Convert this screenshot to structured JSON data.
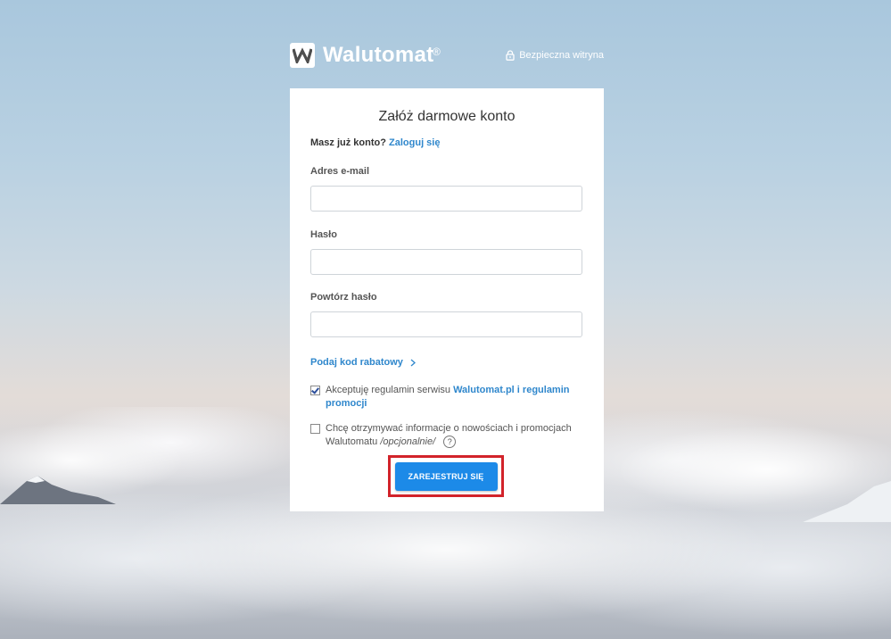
{
  "brand": {
    "name": "Walutomat",
    "mark": "W",
    "registered": "®",
    "secure_label": "Bezpieczna witryna"
  },
  "form": {
    "title": "Załóż darmowe konto",
    "have_account": "Masz już konto?",
    "login_link": "Zaloguj się",
    "email_label": "Adres e-mail",
    "email_value": "",
    "password_label": "Hasło",
    "password_value": "",
    "repeat_label": "Powtórz hasło",
    "repeat_value": "",
    "promo_label": "Podaj kod rabatowy",
    "terms": {
      "checked": true,
      "text": "Akceptuję regulamin serwisu",
      "link1": "Walutomat.pl",
      "text2": "i",
      "link2": "regulamin promocji"
    },
    "newsletter": {
      "checked": false,
      "text": "Chcę otrzymywać informacje o nowościach i promocjach Walutomatu",
      "optional": "/opcjonalnie/",
      "help": "?"
    },
    "submit_label": "ZAREJESTRUJ SIĘ"
  },
  "colors": {
    "accent": "#1c8ae8",
    "link": "#2f87cc",
    "highlight": "#d2232a"
  }
}
